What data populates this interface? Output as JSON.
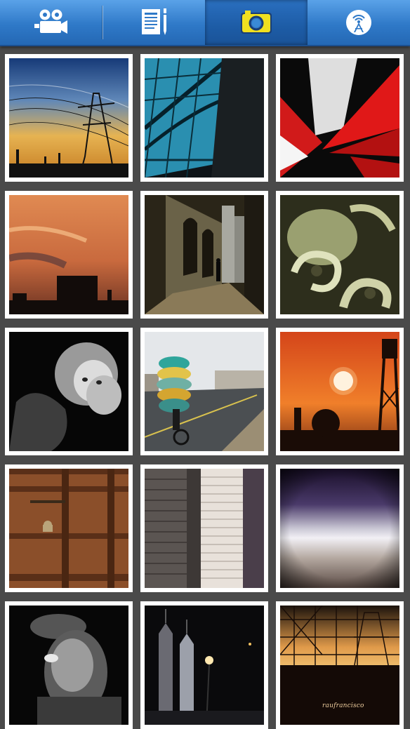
{
  "tabs": [
    {
      "icon": "video-camera-icon",
      "active": false
    },
    {
      "icon": "document-pen-icon",
      "active": false
    },
    {
      "icon": "camera-icon",
      "active": true
    },
    {
      "icon": "broadcast-tower-icon",
      "active": false
    }
  ],
  "colors": {
    "tabbar": "#2f79c8",
    "tab_active": "#1d5ca6",
    "camera_icon_fill": "#f0e020",
    "background": "#4a4a4a",
    "thumb_border": "#ffffff"
  },
  "gallery": {
    "photos": [
      {
        "name": "power-pylon-sunset-photo"
      },
      {
        "name": "glass-roof-photo"
      },
      {
        "name": "red-white-abstract-photo"
      },
      {
        "name": "orange-sky-silhouette-photo"
      },
      {
        "name": "arched-alley-photo"
      },
      {
        "name": "carved-stone-scroll-photo"
      },
      {
        "name": "cherub-statue-photo"
      },
      {
        "name": "bicycle-loaded-fabrics-photo"
      },
      {
        "name": "orange-sun-tower-photo"
      },
      {
        "name": "wooden-door-padlock-photo"
      },
      {
        "name": "skyscrapers-photo"
      },
      {
        "name": "purple-gradient-photo"
      },
      {
        "name": "smoking-man-photo"
      },
      {
        "name": "night-towers-photo"
      },
      {
        "name": "scaffolding-sunset-photo",
        "watermark": "raufrancisco"
      }
    ]
  }
}
